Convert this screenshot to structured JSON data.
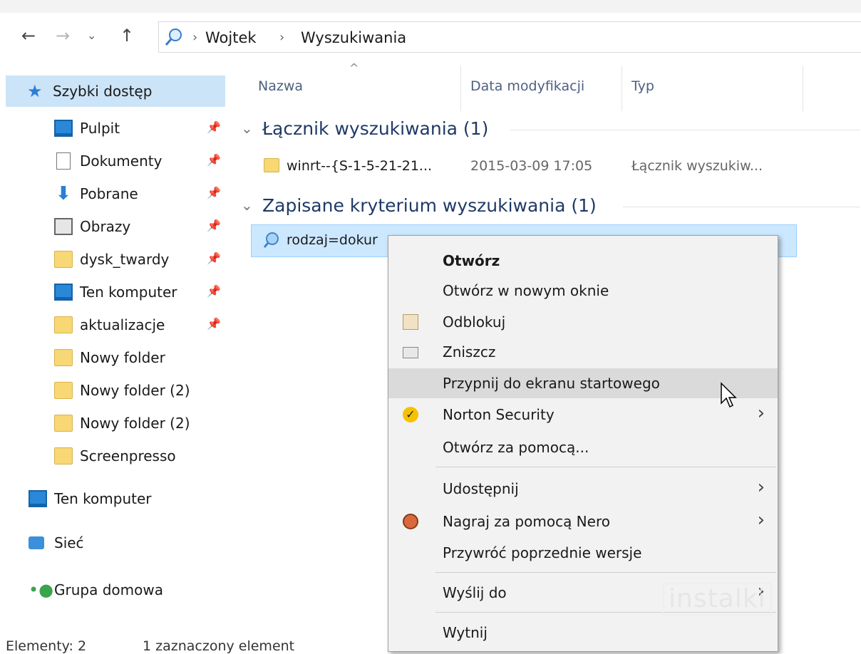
{
  "breadcrumb": {
    "items": [
      "Wojtek",
      "Wyszukiwania"
    ]
  },
  "sidebar": {
    "items": [
      {
        "label": "Szybki dostęp",
        "icon": "star-icon"
      },
      {
        "label": "Pulpit",
        "icon": "desktop-icon"
      },
      {
        "label": "Dokumenty",
        "icon": "documents-icon"
      },
      {
        "label": "Pobrane",
        "icon": "download-arrow-icon"
      },
      {
        "label": "Obrazy",
        "icon": "pictures-icon"
      },
      {
        "label": "dysk_twardy",
        "icon": "folder-icon"
      },
      {
        "label": "Ten komputer",
        "icon": "computer-icon"
      },
      {
        "label": "aktualizacje",
        "icon": "folder-icon"
      },
      {
        "label": "Nowy folder",
        "icon": "folder-icon"
      },
      {
        "label": "Nowy folder (2)",
        "icon": "folder-icon"
      },
      {
        "label": "Nowy folder (2)",
        "icon": "folder-icon"
      },
      {
        "label": "Screenpresso",
        "icon": "folder-icon"
      },
      {
        "label": "Ten komputer",
        "icon": "computer-icon"
      },
      {
        "label": "Sieć",
        "icon": "network-icon"
      },
      {
        "label": "Grupa domowa",
        "icon": "homegroup-icon"
      }
    ]
  },
  "columns": {
    "name": "Nazwa",
    "date": "Data modyfikacji",
    "type": "Typ"
  },
  "groups": [
    {
      "title": "Łącznik wyszukiwania (1)",
      "rows": [
        {
          "name": "winrt--{S-1-5-21-21...",
          "date": "2015-03-09 17:05",
          "type": "Łącznik wyszukiw..."
        }
      ]
    },
    {
      "title": "Zapisane kryterium wyszukiwania (1)",
      "rows": [
        {
          "name": "rodzaj=dokur",
          "date": "",
          "type": ""
        }
      ]
    }
  ],
  "status": {
    "count": "Elementy: 2",
    "selected": "1 zaznaczony element"
  },
  "context_menu": {
    "items": [
      {
        "label": "Otwórz"
      },
      {
        "label": "Otwórz w nowym oknie"
      },
      {
        "label": "Odblokuj"
      },
      {
        "label": "Zniszcz"
      },
      {
        "label": "Przypnij do ekranu startowego"
      },
      {
        "label": "Norton Security"
      },
      {
        "label": "Otwórz za pomocą..."
      },
      {
        "label": "Udostępnij"
      },
      {
        "label": "Nagraj za pomocą Nero"
      },
      {
        "label": "Przywróć poprzednie wersje"
      },
      {
        "label": "Wyślij do"
      },
      {
        "label": "Wytnij"
      }
    ]
  },
  "watermark": "instalki"
}
